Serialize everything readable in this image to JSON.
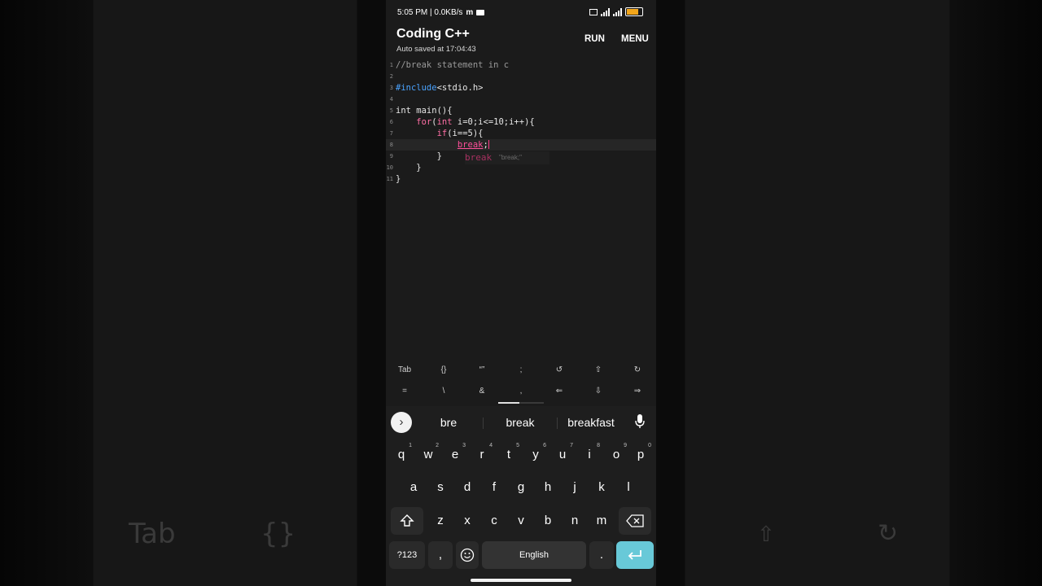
{
  "status": {
    "time_info": "5:05 PM | 0.0KB/s",
    "carrier_icon": "m"
  },
  "app": {
    "title": "Coding C++",
    "autosave": "Auto saved at 17:04:43",
    "run_label": "RUN",
    "menu_label": "MENU"
  },
  "editor": {
    "line_numbers": [
      "1",
      "2",
      "3",
      "4",
      "5",
      "6",
      "7",
      "8",
      "9",
      "10",
      "11"
    ],
    "l1": "//break statement in c",
    "l3_pre": "#include",
    "l3_rest": "<stdio.h>",
    "l5": "int main(){",
    "l6_kw": "for",
    "l6_a": "(",
    "l6_kw2": "int",
    "l6_b": " i=0;i<=10;i++){",
    "l7_kw": "if",
    "l7_rest": "(i==5){",
    "l8_kw": "break",
    "l8_rest": ";",
    "l9": "}",
    "l10": "}",
    "l11": "}",
    "autocomplete_word": "break",
    "autocomplete_hint": "\"break;\""
  },
  "extra_keys": {
    "row1": [
      "Tab",
      "{}",
      "“”",
      ";",
      "↺",
      "⇧",
      "↻"
    ],
    "row2": [
      "=",
      "\\",
      "&",
      ",",
      "⇐",
      "⇩",
      "⇒"
    ]
  },
  "keyboard": {
    "suggestions": [
      "bre",
      "break",
      "breakfast"
    ],
    "row1": [
      "q",
      "w",
      "e",
      "r",
      "t",
      "y",
      "u",
      "i",
      "o",
      "p"
    ],
    "row1_hints": [
      "1",
      "2",
      "3",
      "4",
      "5",
      "6",
      "7",
      "8",
      "9",
      "0"
    ],
    "row2": [
      "a",
      "s",
      "d",
      "f",
      "g",
      "h",
      "j",
      "k",
      "l"
    ],
    "row3": [
      "z",
      "x",
      "c",
      "v",
      "b",
      "n",
      "m"
    ],
    "sym_label": "?123",
    "comma": ",",
    "space_label": "English",
    "period": "."
  },
  "background_ghost": {
    "left_tab": "Tab",
    "left_braces": "{}"
  },
  "colors": {
    "accent_enter": "#68c9d8",
    "keyword": "#ff6fa5",
    "preprocessor": "#4aa3ff"
  }
}
